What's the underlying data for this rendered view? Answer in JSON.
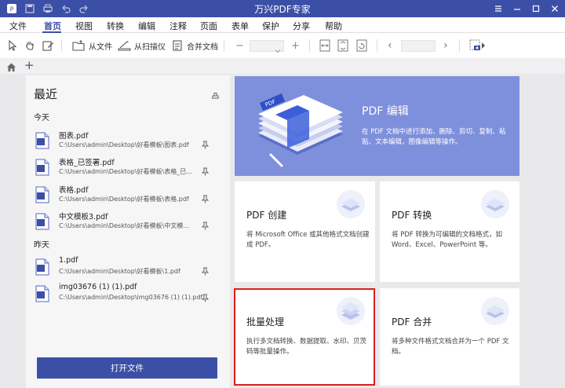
{
  "titlebar": {
    "title": "万兴PDF专家",
    "quick_icons": [
      "app-logo-icon",
      "save-icon",
      "print-icon",
      "undo-icon",
      "redo-icon"
    ],
    "window_buttons": [
      "menu-icon",
      "minimize-icon",
      "maximize-icon",
      "close-icon"
    ]
  },
  "menu": {
    "items": [
      {
        "label": "文件"
      },
      {
        "label": "首页"
      },
      {
        "label": "视图"
      },
      {
        "label": "转换"
      },
      {
        "label": "编辑"
      },
      {
        "label": "注释"
      },
      {
        "label": "页面"
      },
      {
        "label": "表单"
      },
      {
        "label": "保护"
      },
      {
        "label": "分享"
      },
      {
        "label": "帮助"
      }
    ],
    "active": "首页"
  },
  "toolbar": {
    "from_file": "从文件",
    "from_scanner": "从扫描仪",
    "combine": "合并文档",
    "zoom_out": "−",
    "zoom_in": "+",
    "prev_page": "‹",
    "next_page": "›"
  },
  "tabrow": {
    "add_tab": "+"
  },
  "recent": {
    "title": "最近",
    "today_label": "今天",
    "yesterday_label": "昨天",
    "today": [
      {
        "name": "图表.pdf",
        "path": "C:\\Users\\admin\\Desktop\\好看模板\\图表.pdf"
      },
      {
        "name": "表格_已签署.pdf",
        "path": "C:\\Users\\admin\\Desktop\\好看模板\\表格_已..."
      },
      {
        "name": "表格.pdf",
        "path": "C:\\Users\\admin\\Desktop\\好看模板\\表格.pdf"
      },
      {
        "name": "中文模板3.pdf",
        "path": "C:\\Users\\admin\\Desktop\\好看模板\\中文模..."
      }
    ],
    "yesterday": [
      {
        "name": "1.pdf",
        "path": "C:\\Users\\admin\\Desktop\\好看模板\\1.pdf"
      },
      {
        "name": "img03676 (1) (1).pdf",
        "path": "C:\\Users\\admin\\Desktop\\img03676 (1) (1).pdf"
      }
    ],
    "open_button": "打开文件"
  },
  "hero": {
    "title": "PDF 编辑",
    "desc": "在 PDF 文档中进行添加、删除、剪切、复制、粘贴、文本编辑，图像编辑等操作。"
  },
  "cards": [
    {
      "title": "PDF 创建",
      "desc": "将 Microsoft Office 或其他格式文档创建成 PDF。"
    },
    {
      "title": "PDF 转换",
      "desc": "将 PDF 转换为可编辑的文档格式，如 Word、Excel、PowerPoint 等。"
    },
    {
      "title": "批量处理",
      "desc": "执行多文档转换、数据提取、水印、贝茨码等批量操作。"
    },
    {
      "title": "PDF 合并",
      "desc": "将多种文件格式文档合并为一个 PDF 文档。"
    }
  ],
  "colors": {
    "brand": "#3c4fa6",
    "hero": "#7e8fdc",
    "highlight": "#d9201c"
  }
}
